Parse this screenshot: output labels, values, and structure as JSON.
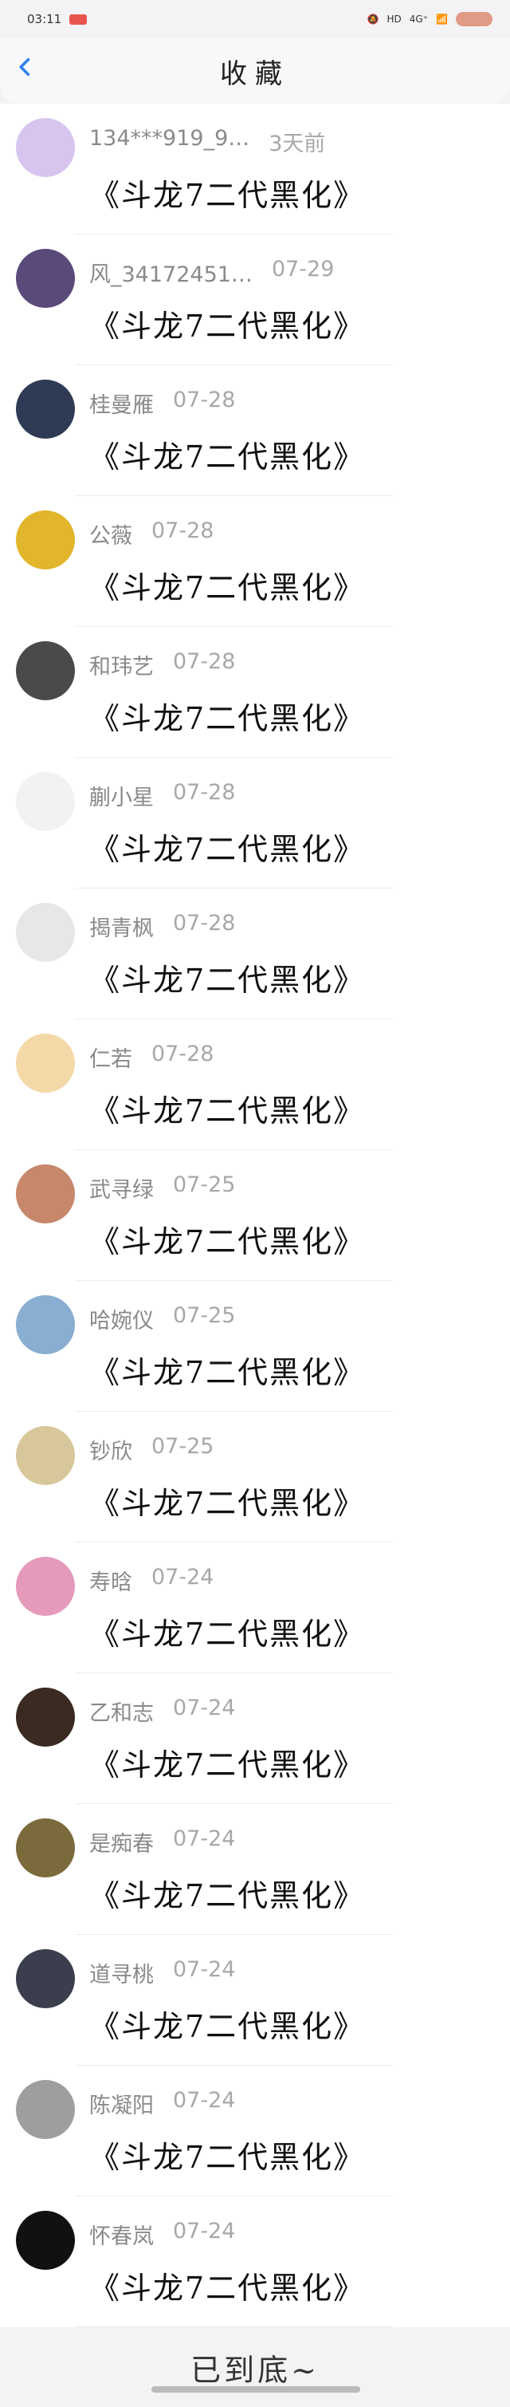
{
  "status": {
    "time": "03:11",
    "net": "4G⁺",
    "hd": "HD"
  },
  "header": {
    "title": "收藏"
  },
  "items": [
    {
      "user": "134***919_9…",
      "time": "3天前",
      "title": "《斗龙7二代黑化》",
      "avatar_color": "#d7c5f0"
    },
    {
      "user": "风_34172451…",
      "time": "07-29",
      "title": "《斗龙7二代黑化》",
      "avatar_color": "#5a4a7a"
    },
    {
      "user": "桂曼雁",
      "time": "07-28",
      "title": "《斗龙7二代黑化》",
      "avatar_color": "#2f3b55"
    },
    {
      "user": "公薇",
      "time": "07-28",
      "title": "《斗龙7二代黑化》",
      "avatar_color": "#e2b62c"
    },
    {
      "user": "和玮艺",
      "time": "07-28",
      "title": "《斗龙7二代黑化》",
      "avatar_color": "#4a4a4a"
    },
    {
      "user": "蒯小星",
      "time": "07-28",
      "title": "《斗龙7二代黑化》",
      "avatar_color": "#f2f2f2"
    },
    {
      "user": "揭青枫",
      "time": "07-28",
      "title": "《斗龙7二代黑化》",
      "avatar_color": "#e7e7e7"
    },
    {
      "user": "仁若",
      "time": "07-28",
      "title": "《斗龙7二代黑化》",
      "avatar_color": "#f4d9a8"
    },
    {
      "user": "武寻绿",
      "time": "07-25",
      "title": "《斗龙7二代黑化》",
      "avatar_color": "#c6876a"
    },
    {
      "user": "哈婉仪",
      "time": "07-25",
      "title": "《斗龙7二代黑化》",
      "avatar_color": "#8aaed2"
    },
    {
      "user": "钞欣",
      "time": "07-25",
      "title": "《斗龙7二代黑化》",
      "avatar_color": "#d8c79a"
    },
    {
      "user": "寿晗",
      "time": "07-24",
      "title": "《斗龙7二代黑化》",
      "avatar_color": "#e59abb"
    },
    {
      "user": "乙和志",
      "time": "07-24",
      "title": "《斗龙7二代黑化》",
      "avatar_color": "#3a2a22"
    },
    {
      "user": "是痴春",
      "time": "07-24",
      "title": "《斗龙7二代黑化》",
      "avatar_color": "#7b6a3c"
    },
    {
      "user": "道寻桃",
      "time": "07-24",
      "title": "《斗龙7二代黑化》",
      "avatar_color": "#3b3f4d"
    },
    {
      "user": "陈凝阳",
      "time": "07-24",
      "title": "《斗龙7二代黑化》",
      "avatar_color": "#9e9e9e"
    },
    {
      "user": "怀春岚",
      "time": "07-24",
      "title": "《斗龙7二代黑化》",
      "avatar_color": "#111111"
    }
  ],
  "footer": {
    "text": "已到底~"
  }
}
